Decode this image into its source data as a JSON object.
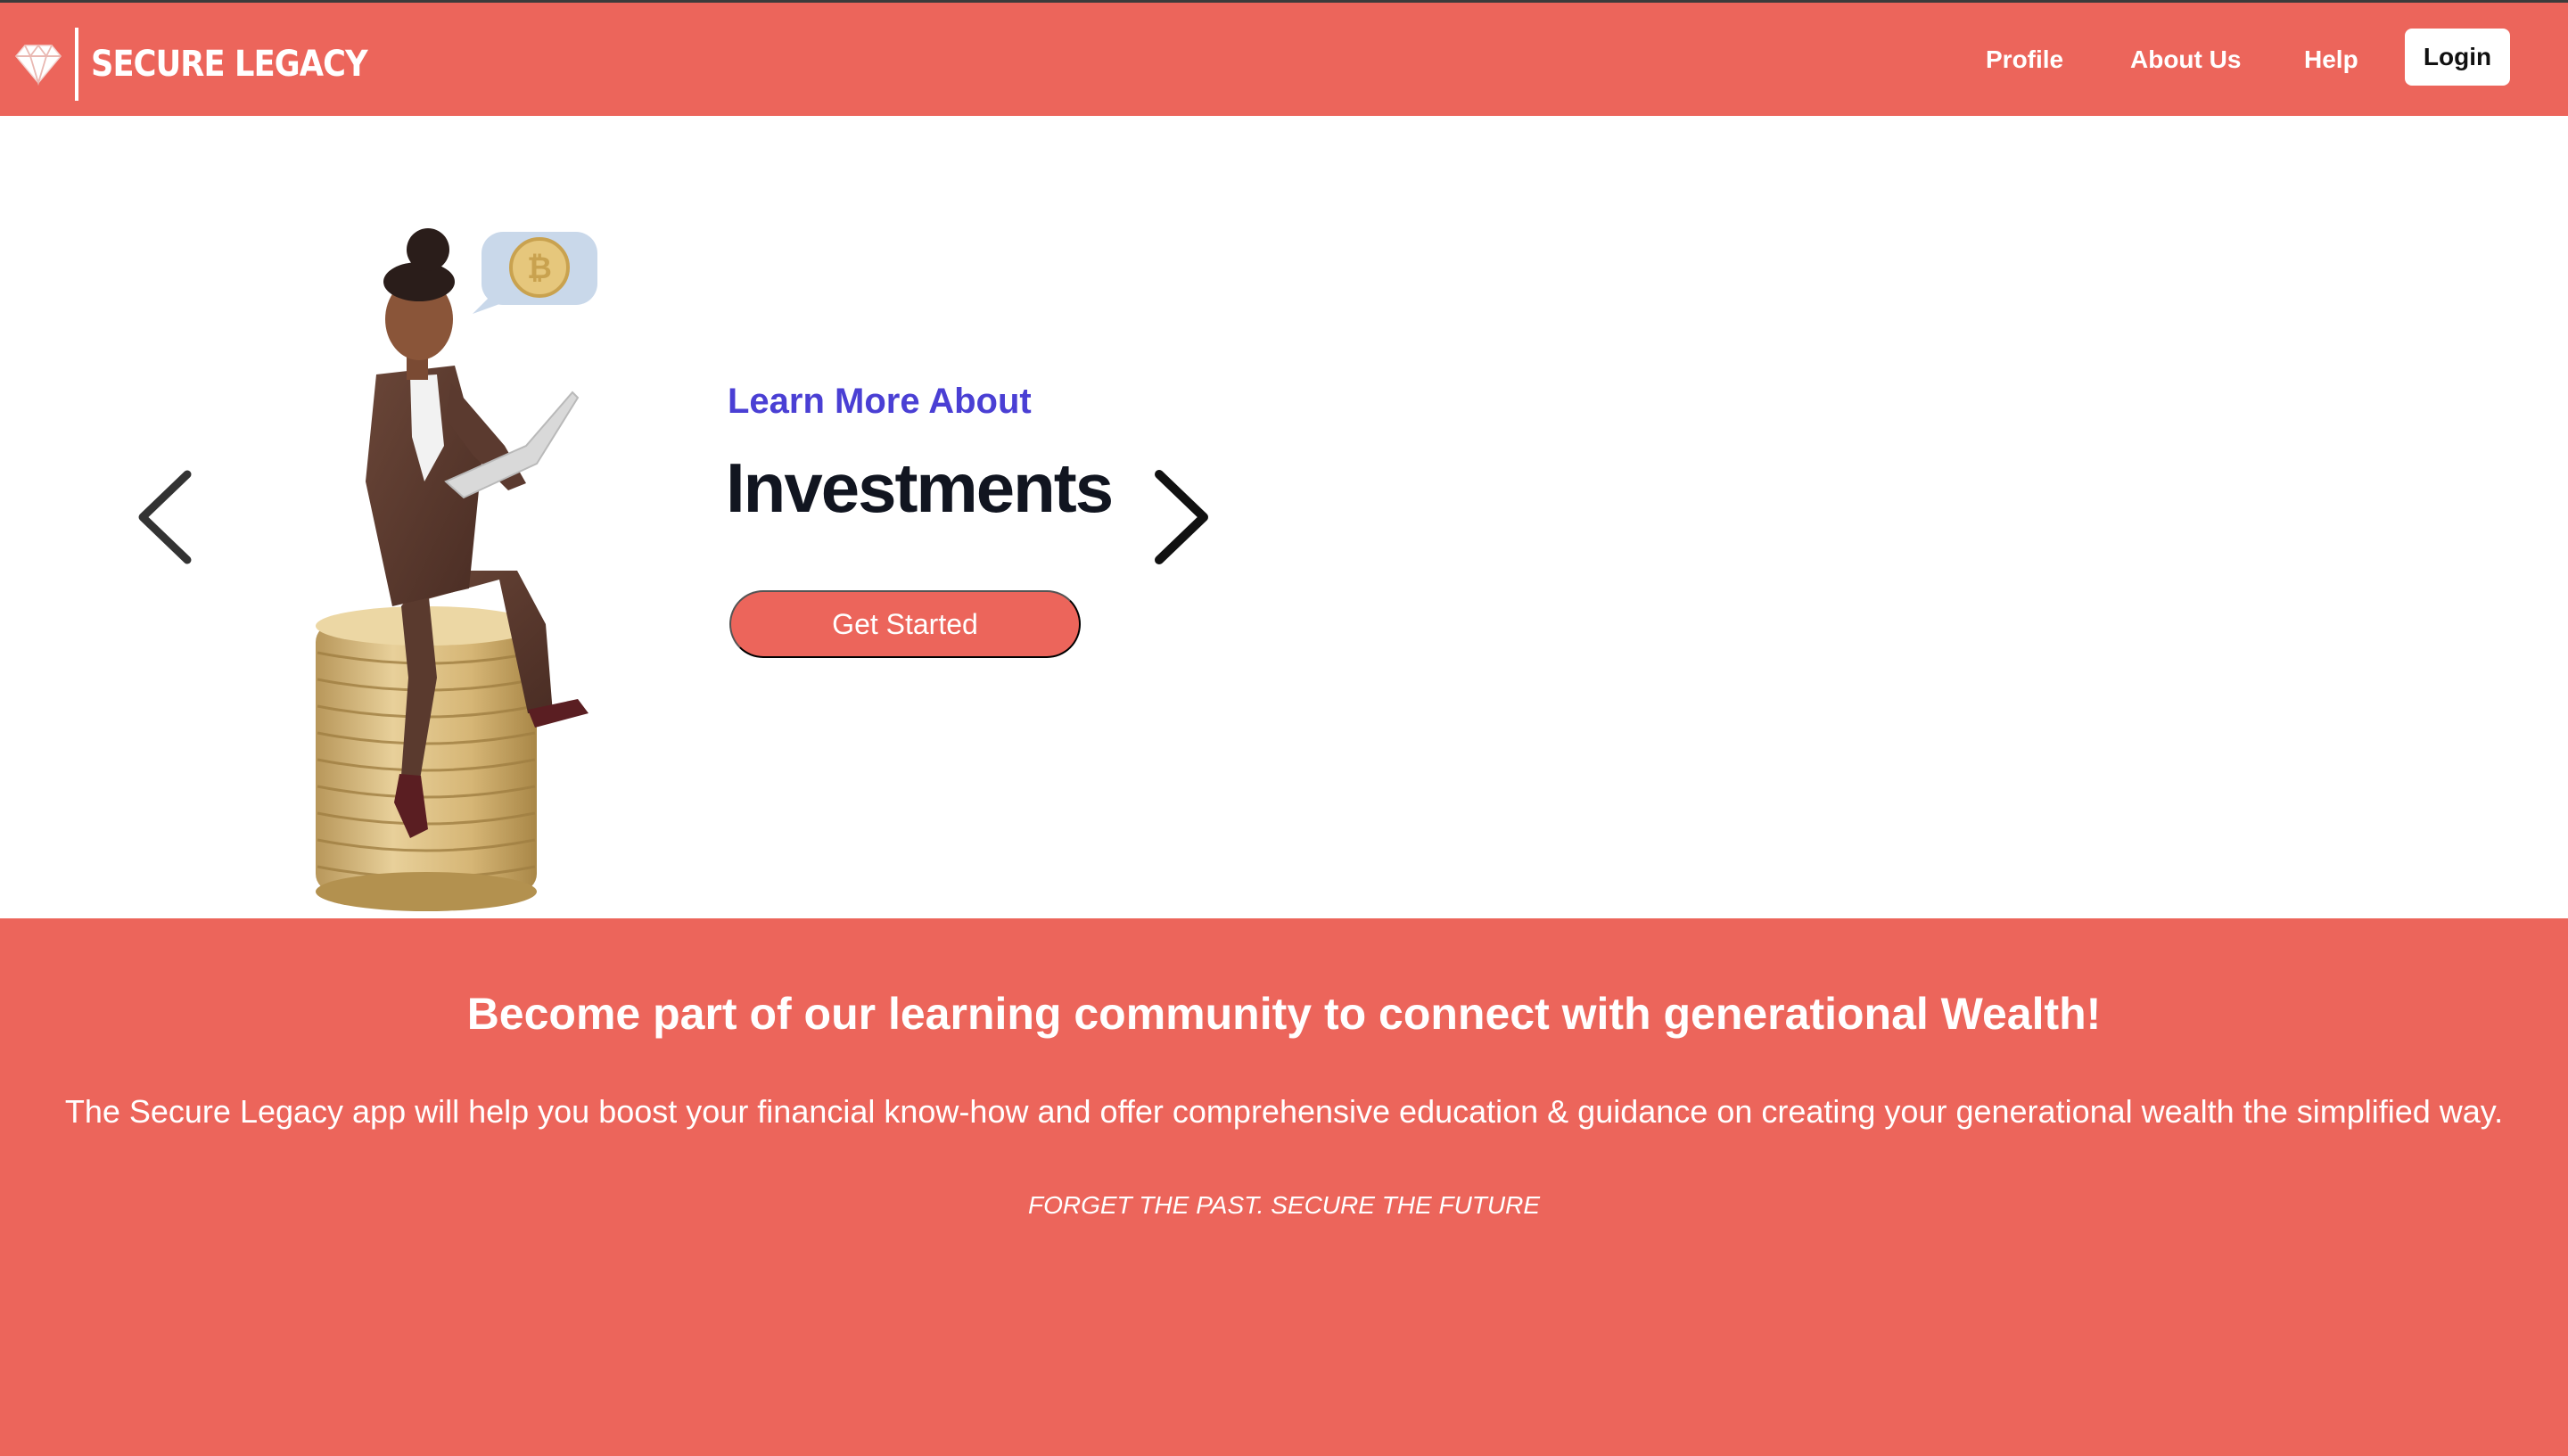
{
  "brand": {
    "name": "SECURE LEGACY",
    "logo_icon": "diamond-icon"
  },
  "nav": {
    "links": [
      "Profile",
      "About Us",
      "Help"
    ],
    "login_label": "Login"
  },
  "hero": {
    "kicker": "Learn More About",
    "title": "Investments",
    "cta_label": "Get Started",
    "prev_icon": "chevron-left-icon",
    "next_icon": "chevron-right-icon",
    "illustration": "woman-on-coin-stack-with-laptop-illustration"
  },
  "community": {
    "heading": "Become part of our learning community to connect with generational Wealth!",
    "description": "The Secure Legacy app will help you boost your financial know-how and offer comprehensive education & guidance on creating your generational wealth the simplified way.",
    "tagline": "FORGET THE PAST. SECURE THE FUTURE"
  },
  "colors": {
    "brand_coral": "#EC655B",
    "kicker_indigo": "#4A3FD4",
    "title_dark": "#111520",
    "white": "#FFFFFF"
  }
}
